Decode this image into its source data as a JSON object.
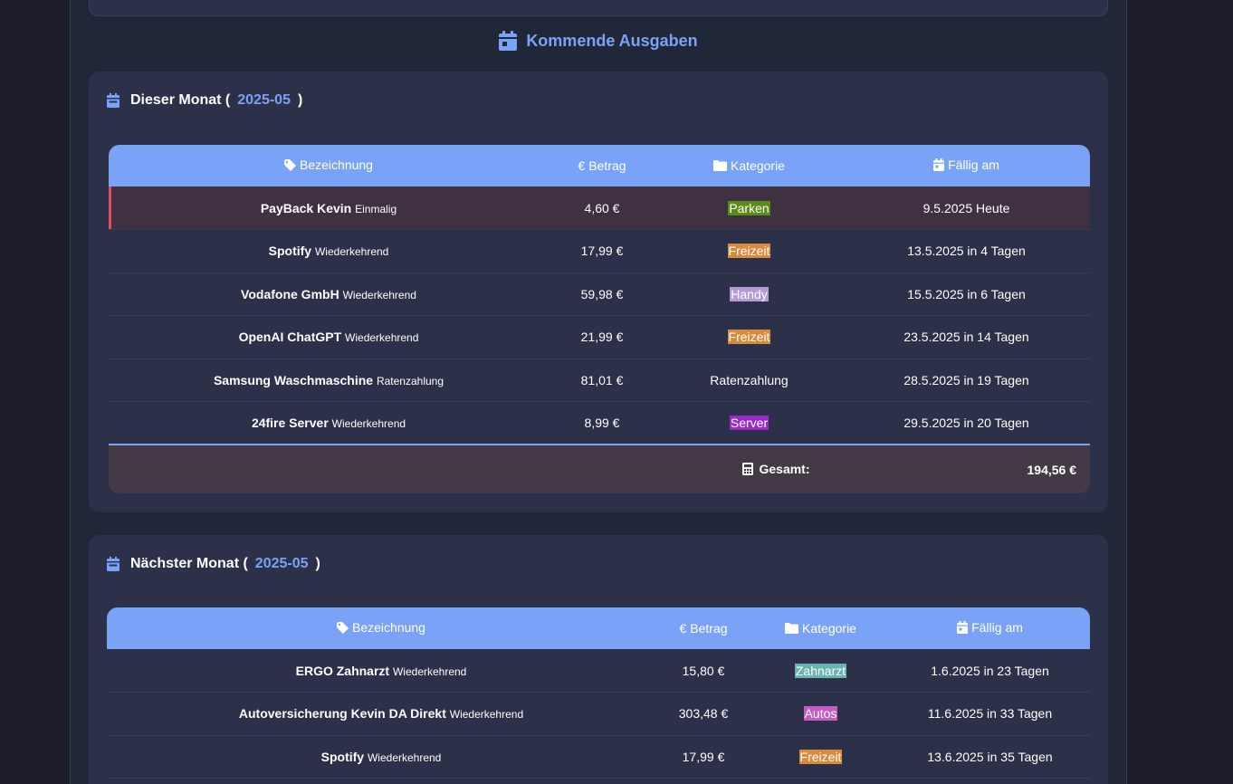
{
  "heading": "Kommende Ausgaben",
  "columns": {
    "name": "Bezeichnung",
    "amount": "Betrag",
    "category": "Kategorie",
    "due": "Fällig am"
  },
  "colors": {
    "accent": "#7aa2f7",
    "today_marker": "#e0505c"
  },
  "this_month": {
    "title_prefix": "Dieser Monat (",
    "month": "2025-05",
    "title_suffix": ")",
    "rows": [
      {
        "name": "PayBack Kevin",
        "type": "Einmalig",
        "amount": "4,60 €",
        "category": "Parken",
        "category_color": "#5a8c1a",
        "due": "9.5.2025 Heute"
      },
      {
        "name": "Spotify",
        "type": "Wiederkehrend",
        "amount": "17,99 €",
        "category": "Freizeit",
        "category_color": "#d98a3d",
        "due": "13.5.2025 in 4 Tagen"
      },
      {
        "name": "Vodafone GmbH",
        "type": "Wiederkehrend",
        "amount": "59,98 €",
        "category": "Handy",
        "category_color": "#b69bd6",
        "due": "15.5.2025 in 6 Tagen"
      },
      {
        "name": "OpenAI ChatGPT",
        "type": "Wiederkehrend",
        "amount": "21,99 €",
        "category": "Freizeit",
        "category_color": "#d98a3d",
        "due": "23.5.2025 in 14 Tagen"
      },
      {
        "name": "Samsung Waschmaschine",
        "type": "Ratenzahlung",
        "amount": "81,01 €",
        "category": "Ratenzahlung",
        "category_color": "",
        "due": "28.5.2025 in 19 Tagen"
      },
      {
        "name": "24fire Server",
        "type": "Wiederkehrend",
        "amount": "8,99 €",
        "category": "Server",
        "category_color": "#9a2bc7",
        "due": "29.5.2025 in 20 Tagen"
      }
    ],
    "total_label": "Gesamt:",
    "total_value": "194,56 €"
  },
  "next_month": {
    "title_prefix": "Nächster Monat (",
    "month": "2025-05",
    "title_suffix": ")",
    "rows": [
      {
        "name": "ERGO Zahnarzt",
        "type": "Wiederkehrend",
        "amount": "15,80 €",
        "category": "Zahnarzt",
        "category_color": "#6ab3b3",
        "due": "1.6.2025 in 23 Tagen"
      },
      {
        "name": "Autoversicherung Kevin DA Direkt",
        "type": "Wiederkehrend",
        "amount": "303,48 €",
        "category": "Autos",
        "category_color": "#c45cc4",
        "due": "11.6.2025 in 33 Tagen"
      },
      {
        "name": "Spotify",
        "type": "Wiederkehrend",
        "amount": "17,99 €",
        "category": "Freizeit",
        "category_color": "#d98a3d",
        "due": "13.6.2025 in 35 Tagen"
      }
    ]
  }
}
